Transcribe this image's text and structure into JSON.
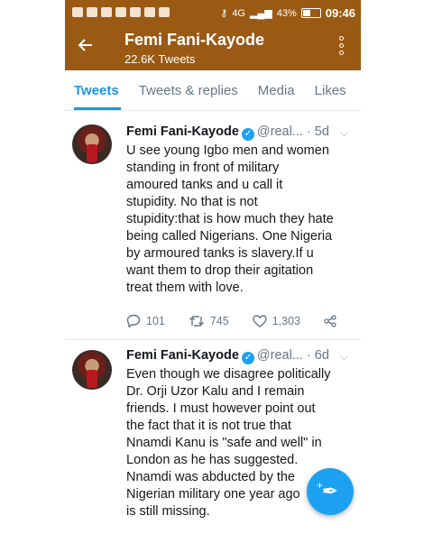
{
  "status": {
    "signal": "4G",
    "battery": "43%",
    "time": "09:46"
  },
  "header": {
    "title": "Femi Fani-Kayode",
    "subtitle": "22.6K Tweets"
  },
  "tabs": [
    {
      "label": "Tweets",
      "active": true
    },
    {
      "label": "Tweets & replies",
      "active": false
    },
    {
      "label": "Media",
      "active": false
    },
    {
      "label": "Likes",
      "active": false
    }
  ],
  "tweets": [
    {
      "name": "Femi Fani-Kayode",
      "handle": "@real...",
      "time": "· 5d",
      "text": "U see young Igbo men and women\nstanding in front of military\namoured tanks and u call it\nstupidity. No that is not\nstupidity:that is how much they hate\nbeing called Nigerians. One Nigeria\nby armoured tanks is slavery.If u\nwant them to drop their agitation\ntreat them with love.",
      "replies": "101",
      "retweets": "745",
      "likes": "1,303"
    },
    {
      "name": "Femi Fani-Kayode",
      "handle": "@real...",
      "time": "· 6d",
      "text": "Even though we disagree politically\nDr. Orji Uzor Kalu and I remain\nfriends. I must however point out\nthe fact that it is not true that\nNnamdi Kanu is \"safe and well\" in\nLondon as he has suggested.\nNnamdi was abducted by the\nNigerian military one year ago\nis still missing."
    }
  ],
  "icons": {
    "verified": "verified-badge-icon",
    "fab": "compose-tweet-icon"
  },
  "colors": {
    "header": "#9a5a13",
    "accent": "#1b95e0"
  }
}
